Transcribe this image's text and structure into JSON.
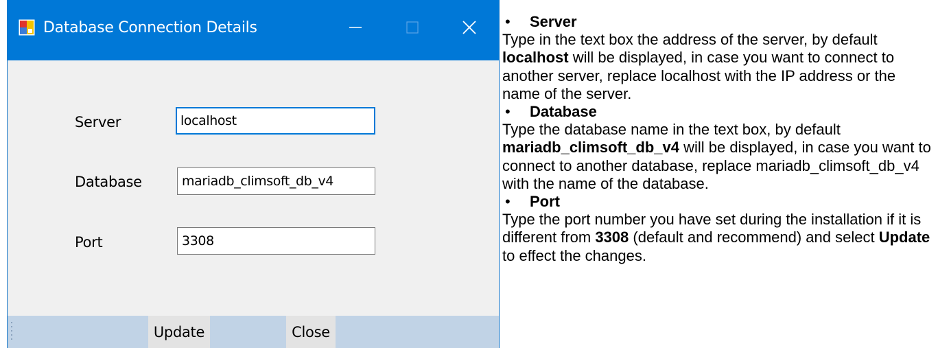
{
  "window": {
    "title": "Database Connection Details",
    "accent_color": "#0078d7",
    "icons": {
      "app": "app-icon",
      "minimize": "minimize-icon",
      "maximize": "maximize-icon",
      "close": "close-icon"
    }
  },
  "form": {
    "server_label": "Server",
    "server_value": "localhost",
    "database_label": "Database",
    "database_value": "mariadb_climsoft_db_v4",
    "port_label": "Port",
    "port_value": "3308"
  },
  "actions": {
    "update_label": "Update",
    "close_label": "Close"
  },
  "help": {
    "server_heading": "Server",
    "server_p1": "Type in the text box the address of the server, by default ",
    "server_bold": "localhost",
    "server_p2": " will be displayed, in case you want to connect to another server, replace localhost with the IP address or the name of the server.",
    "database_heading": "Database",
    "database_p1": "Type the database name in the text box, by default ",
    "database_bold": "mariadb_climsoft_db_v4",
    "database_p2": " will be displayed, in case you want to connect to another database, replace mariadb_climsoft_db_v4 with the name of the database.",
    "port_heading": "Port",
    "port_p1": "Type the port number you have set during the installation if it is different from ",
    "port_bold1": "3308",
    "port_p2": " (default and recommend) and select ",
    "port_bold2": "Update",
    "port_p3": " to effect the changes."
  }
}
